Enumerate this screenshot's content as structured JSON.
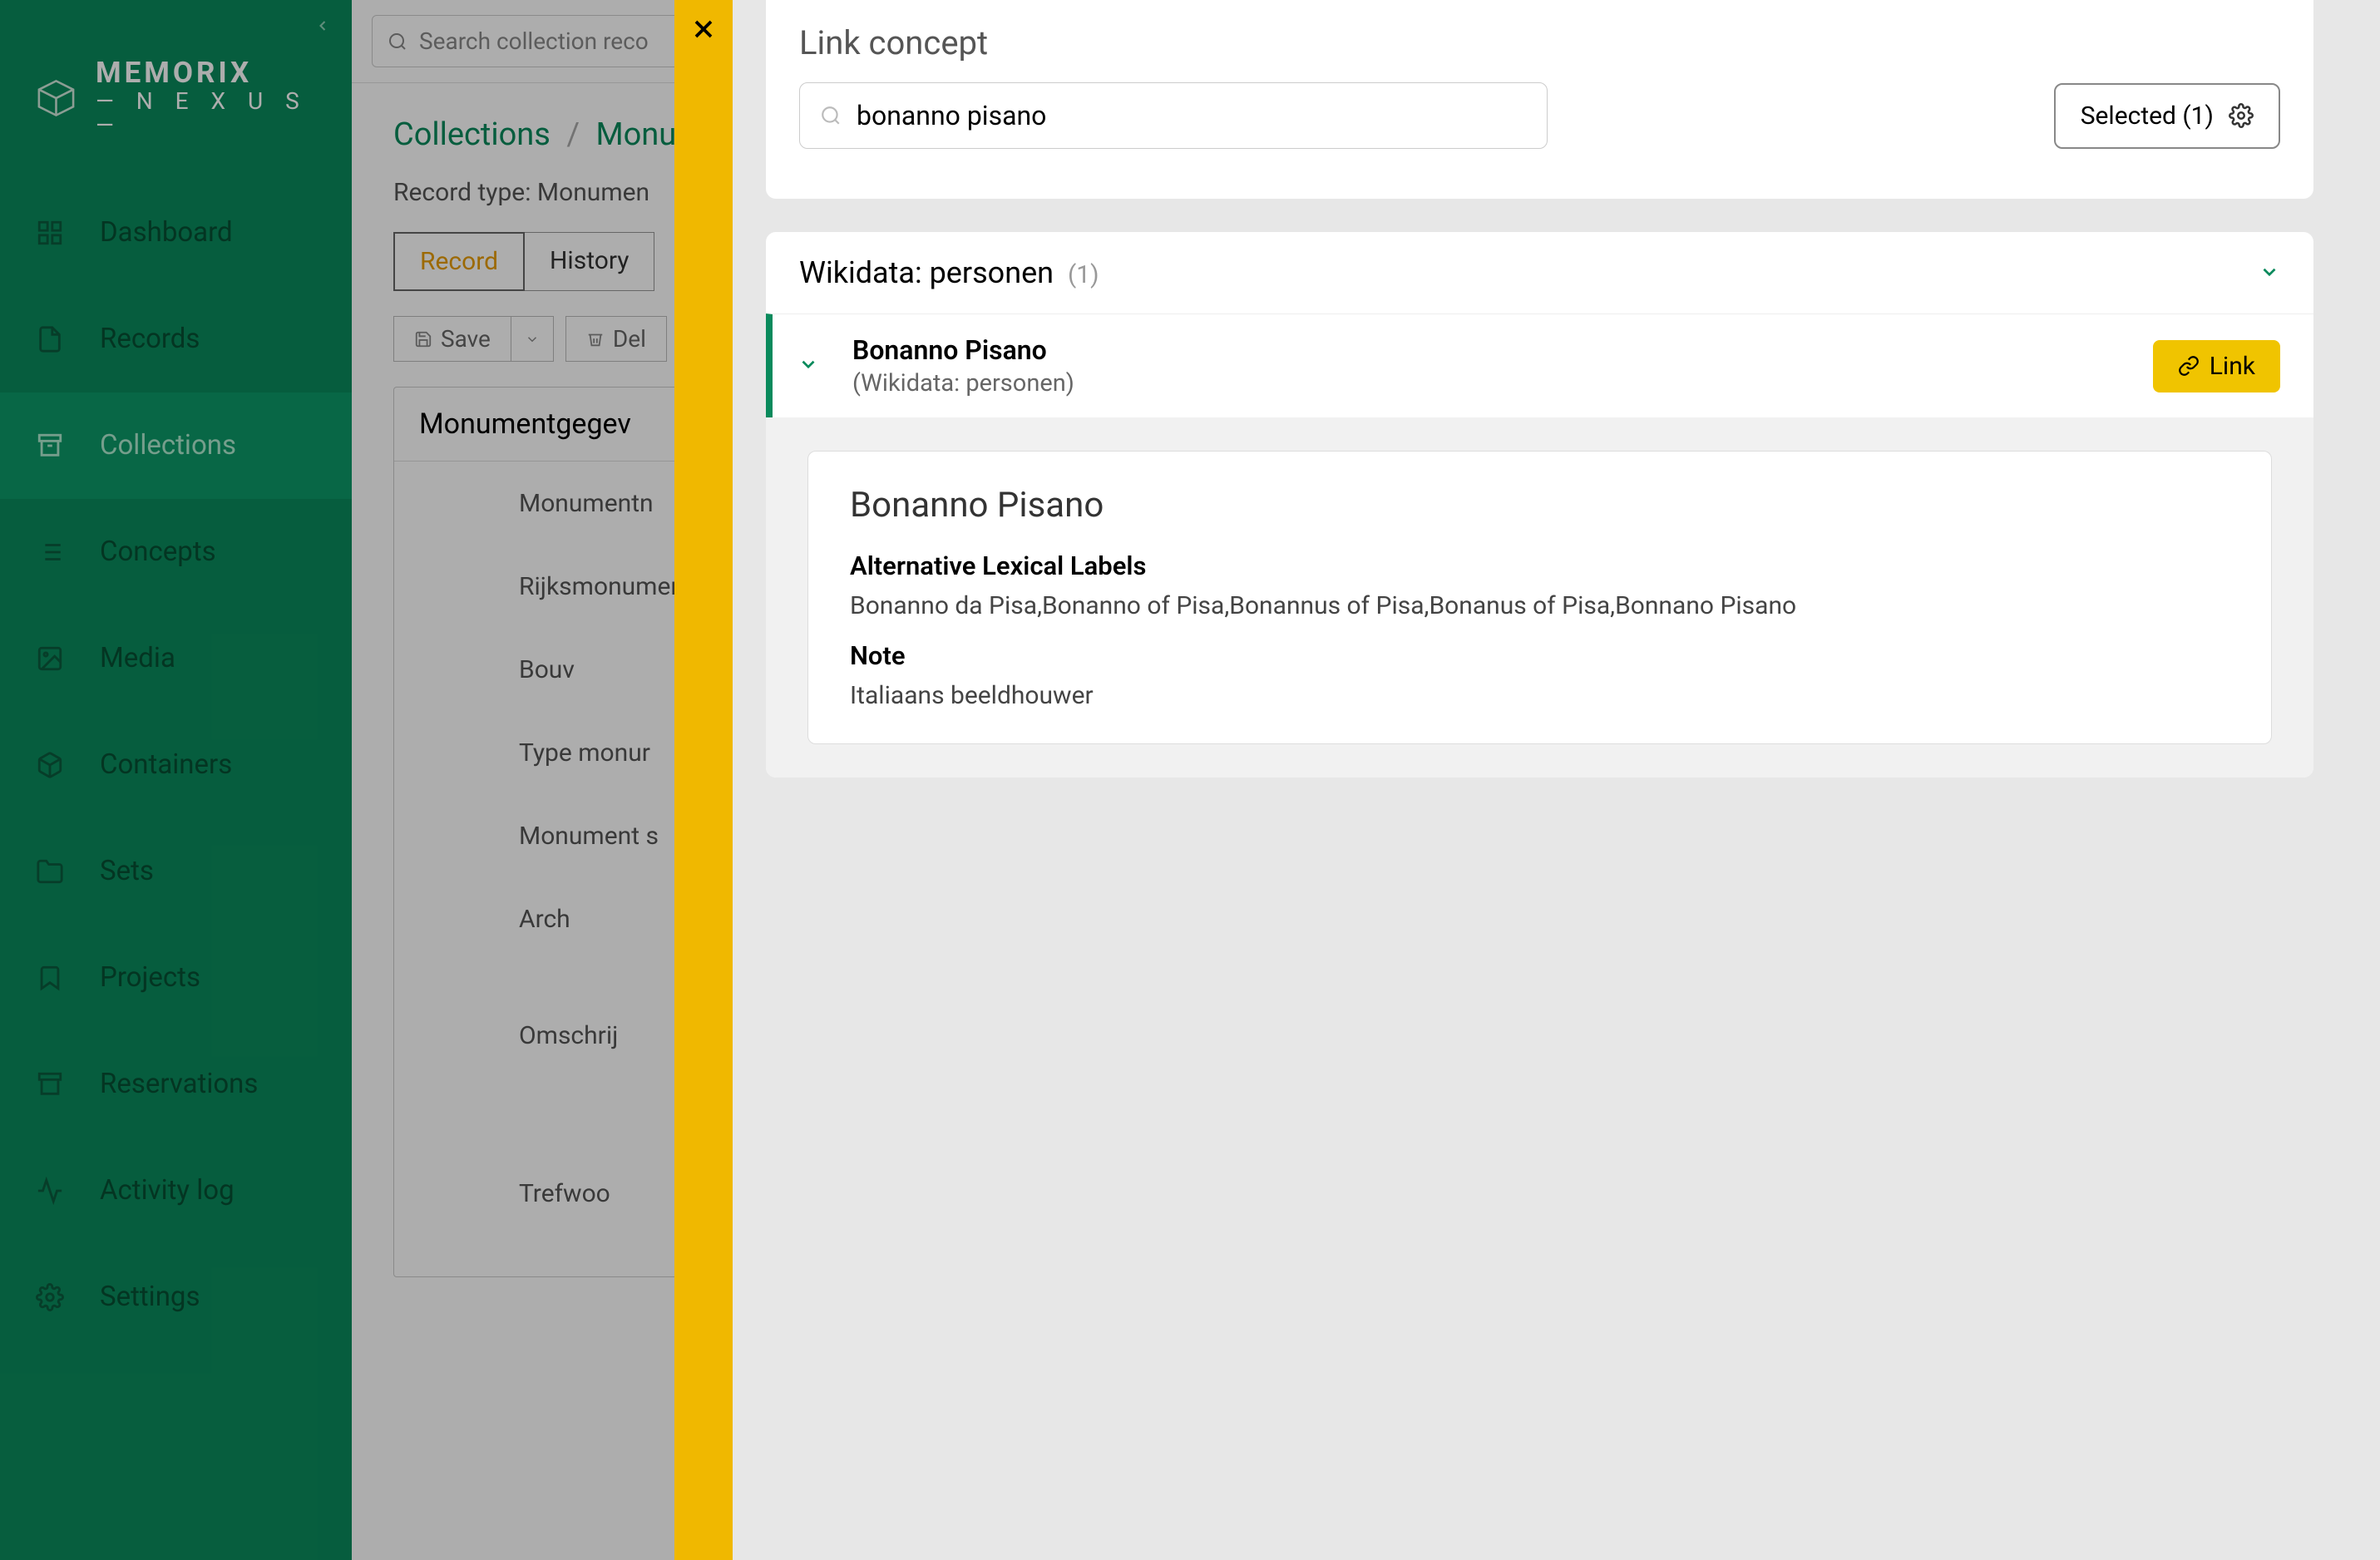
{
  "brand": {
    "name": "MEMORIX",
    "sub": "— N E X U S —"
  },
  "sidebar": {
    "items": [
      {
        "label": "Dashboard"
      },
      {
        "label": "Records"
      },
      {
        "label": "Collections"
      },
      {
        "label": "Concepts"
      },
      {
        "label": "Media"
      },
      {
        "label": "Containers"
      },
      {
        "label": "Sets"
      },
      {
        "label": "Projects"
      },
      {
        "label": "Reservations"
      },
      {
        "label": "Activity log"
      },
      {
        "label": "Settings"
      }
    ]
  },
  "bg": {
    "search_placeholder": "Search collection reco",
    "breadcrumb_root": "Collections",
    "breadcrumb_current": "Monu",
    "record_type": "Record type: Monumen",
    "tabs": {
      "record": "Record",
      "history": "History"
    },
    "actions": {
      "save": "Save",
      "delete": "Del"
    },
    "section_title": "Monumentgegev",
    "fields": [
      "Monumentn",
      "Rijksmonumentnum",
      "Bouv",
      "Type monur",
      "Monument s",
      "Arch",
      "Omschrij",
      "Trefwoo"
    ]
  },
  "panel": {
    "title": "Link concept",
    "search_value": "bonanno pisano",
    "selected_label": "Selected (1)",
    "source_label": "Wikidata: personen",
    "source_count": "(1)",
    "result": {
      "name": "Bonanno Pisano",
      "sub": "(Wikidata: personen)",
      "link_label": "Link"
    },
    "detail": {
      "title": "Bonanno Pisano",
      "alt_label": "Alternative Lexical Labels",
      "alt_values": "Bonanno da Pisa,Bonanno of Pisa,Bonannus of Pisa,Bonanus of Pisa,Bonnano Pisano",
      "note_label": "Note",
      "note_value": "Italiaans beeldhouwer"
    }
  }
}
